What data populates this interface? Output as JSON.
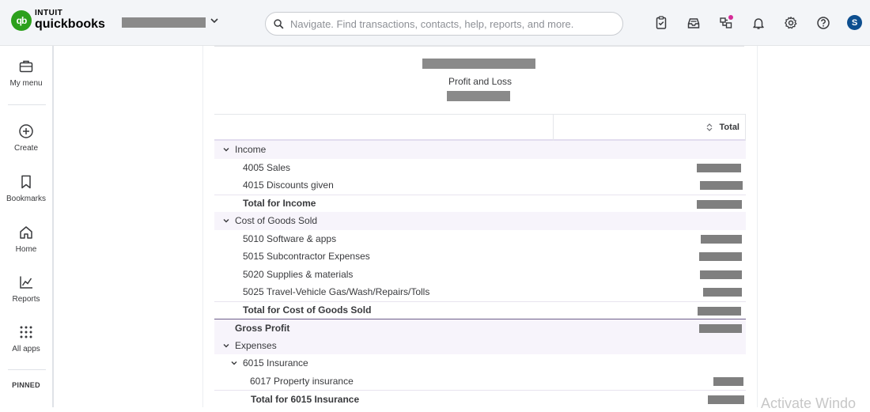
{
  "header": {
    "logo_intuit": "INTUIT",
    "logo_brand": "quickbooks",
    "logo_mark": "qb",
    "search_placeholder": "Navigate. Find transactions, contacts, help, reports, and more.",
    "avatar_initial": "S",
    "icons": [
      "tasks-icon",
      "inbox-icon",
      "apps-notification-icon",
      "bell-icon",
      "gear-icon",
      "help-icon"
    ]
  },
  "nav": {
    "items": [
      {
        "label": "My menu",
        "icon": "briefcase-icon"
      },
      {
        "label": "Create",
        "icon": "plus-circle-icon"
      },
      {
        "label": "Bookmarks",
        "icon": "bookmark-icon"
      },
      {
        "label": "Home",
        "icon": "home-icon"
      },
      {
        "label": "Reports",
        "icon": "chart-icon"
      },
      {
        "label": "All apps",
        "icon": "grid-icon"
      }
    ],
    "pinned_label": "PINNED"
  },
  "report": {
    "title": "Profit and Loss",
    "column_header": "Total",
    "rows": [
      {
        "label": "Income",
        "kind": "section",
        "level": 0
      },
      {
        "label": "4005 Sales",
        "kind": "line",
        "level": 1
      },
      {
        "label": "4015 Discounts given",
        "kind": "line",
        "level": 1
      },
      {
        "label": "Total for Income",
        "kind": "total",
        "level": 1
      },
      {
        "label": "Cost of Goods Sold",
        "kind": "section",
        "level": 0
      },
      {
        "label": "5010 Software & apps",
        "kind": "line",
        "level": 1
      },
      {
        "label": "5015 Subcontractor Expenses",
        "kind": "line",
        "level": 1
      },
      {
        "label": "5020 Supplies & materials",
        "kind": "line",
        "level": 1
      },
      {
        "label": "5025 Travel-Vehicle Gas/Wash/Repairs/Tolls",
        "kind": "line",
        "level": 1
      },
      {
        "label": "Total for Cost of Goods Sold",
        "kind": "total",
        "level": 1
      },
      {
        "label": "Gross Profit",
        "kind": "gross",
        "level": 0
      },
      {
        "label": "Expenses",
        "kind": "section",
        "level": 0
      },
      {
        "label": "6015 Insurance",
        "kind": "subsection",
        "level": 1
      },
      {
        "label": "6017 Property insurance",
        "kind": "line",
        "level": 2
      },
      {
        "label": "Total for 6015 Insurance",
        "kind": "total",
        "level": 2
      }
    ]
  },
  "watermark": "Activate Windo"
}
